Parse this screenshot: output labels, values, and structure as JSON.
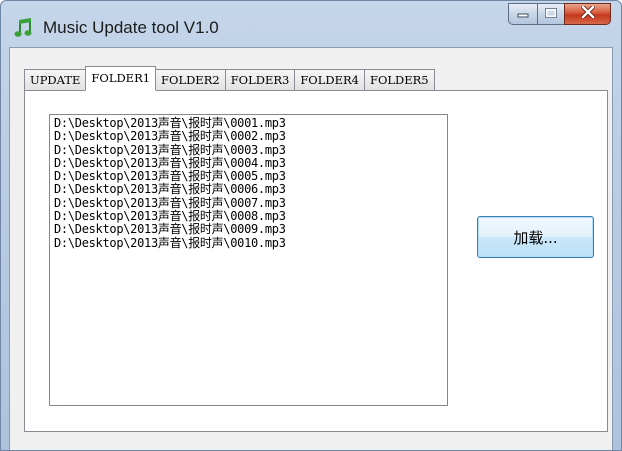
{
  "window": {
    "title": "Music Update tool V1.0",
    "icon": "music-note-icon",
    "controls": [
      "minimize-icon",
      "maximize-icon",
      "close-icon"
    ]
  },
  "tabs": [
    {
      "label": "UPDATE",
      "active": false
    },
    {
      "label": "FOLDER1",
      "active": true
    },
    {
      "label": "FOLDER2",
      "active": false
    },
    {
      "label": "FOLDER3",
      "active": false
    },
    {
      "label": "FOLDER4",
      "active": false
    },
    {
      "label": "FOLDER5",
      "active": false
    }
  ],
  "file_list": {
    "items": [
      "D:\\Desktop\\2013声音\\报时声\\0001.mp3",
      "D:\\Desktop\\2013声音\\报时声\\0002.mp3",
      "D:\\Desktop\\2013声音\\报时声\\0003.mp3",
      "D:\\Desktop\\2013声音\\报时声\\0004.mp3",
      "D:\\Desktop\\2013声音\\报时声\\0005.mp3",
      "D:\\Desktop\\2013声音\\报时声\\0006.mp3",
      "D:\\Desktop\\2013声音\\报时声\\0007.mp3",
      "D:\\Desktop\\2013声音\\报时声\\0008.mp3",
      "D:\\Desktop\\2013声音\\报时声\\0009.mp3",
      "D:\\Desktop\\2013声音\\报时声\\0010.mp3"
    ]
  },
  "buttons": {
    "load_label": "加载..."
  },
  "colors": {
    "title_bar": "#b9cce3",
    "close_button": "#c4381c",
    "button_border": "#3c7fb1"
  }
}
